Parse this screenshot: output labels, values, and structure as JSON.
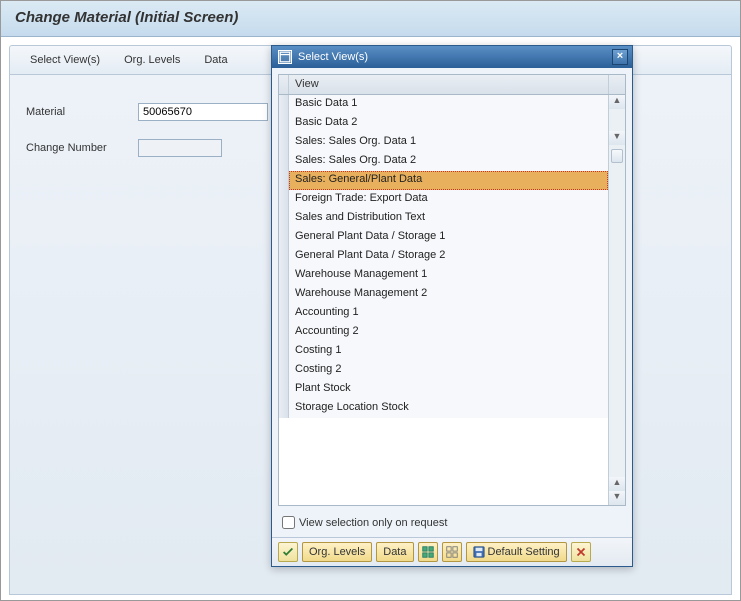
{
  "title": "Change Material (Initial Screen)",
  "menu": [
    "Select View(s)",
    "Org. Levels",
    "Data"
  ],
  "form": {
    "material_label": "Material",
    "material_value": "50065670",
    "change_label": "Change Number",
    "change_value": ""
  },
  "dialog": {
    "title": "Select View(s)",
    "header": "View",
    "selected_index": 4,
    "rows": [
      "Basic Data 1",
      "Basic Data 2",
      "Sales: Sales Org. Data 1",
      "Sales: Sales Org. Data 2",
      "Sales: General/Plant Data",
      "Foreign Trade: Export Data",
      "Sales and Distribution Text",
      "General Plant Data / Storage 1",
      "General Plant Data / Storage 2",
      "Warehouse Management 1",
      "Warehouse Management 2",
      "Accounting 1",
      "Accounting 2",
      "Costing 1",
      "Costing 2",
      "Plant Stock",
      "Storage Location Stock"
    ],
    "checkbox_label": "View selection only on request",
    "footer": {
      "org_levels": "Org. Levels",
      "data": "Data",
      "default_setting": "Default Setting"
    }
  }
}
